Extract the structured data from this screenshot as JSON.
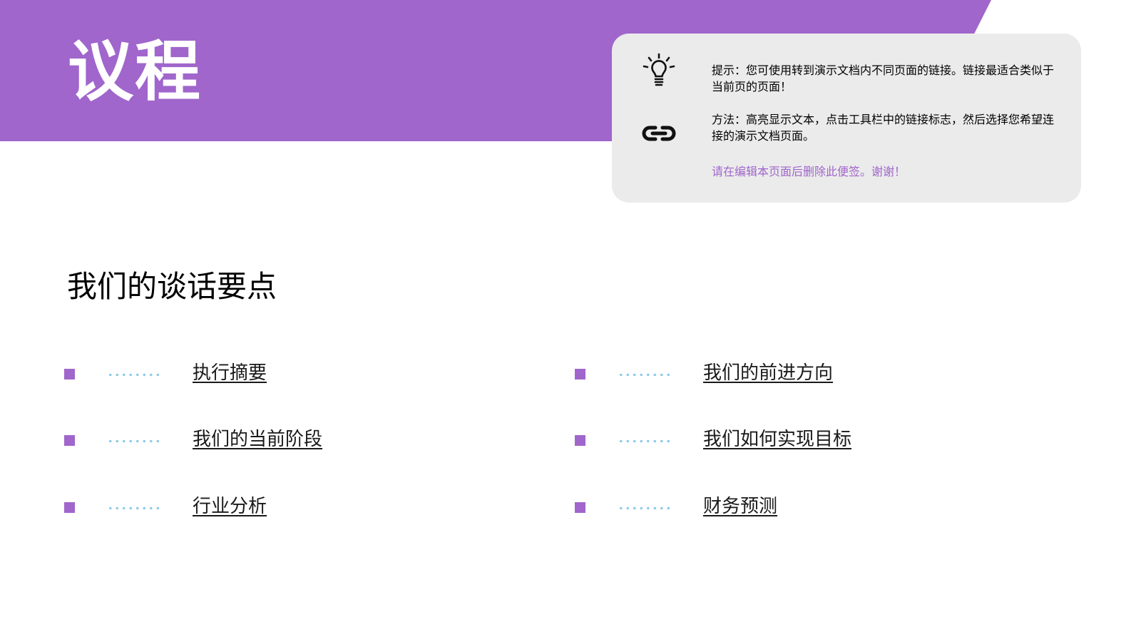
{
  "slide": {
    "title": "议程",
    "subtitle": "我们的谈话要点"
  },
  "tip": {
    "bulb_icon": "lightbulb-icon",
    "link_icon": "link-icon",
    "line1": "提示：您可使用转到演示文档内不同页面的链接。链接最适合类似于当前页的页面！",
    "line2": "方法：高亮显示文本，点击工具栏中的链接标志，然后选择您希望连接的演示文档页面。",
    "line3": "请在编辑本页面后删除此便签。谢谢！"
  },
  "agenda": {
    "left": [
      {
        "label": "执行摘要"
      },
      {
        "label": "我们的当前阶段"
      },
      {
        "label": "行业分析"
      }
    ],
    "right": [
      {
        "label": "我们的前进方向"
      },
      {
        "label": "我们如何实现目标"
      },
      {
        "label": "财务预测"
      }
    ]
  },
  "colors": {
    "accent": "#A066CC",
    "dots": "#8CC9E8",
    "card_bg": "#EBEBEB"
  }
}
